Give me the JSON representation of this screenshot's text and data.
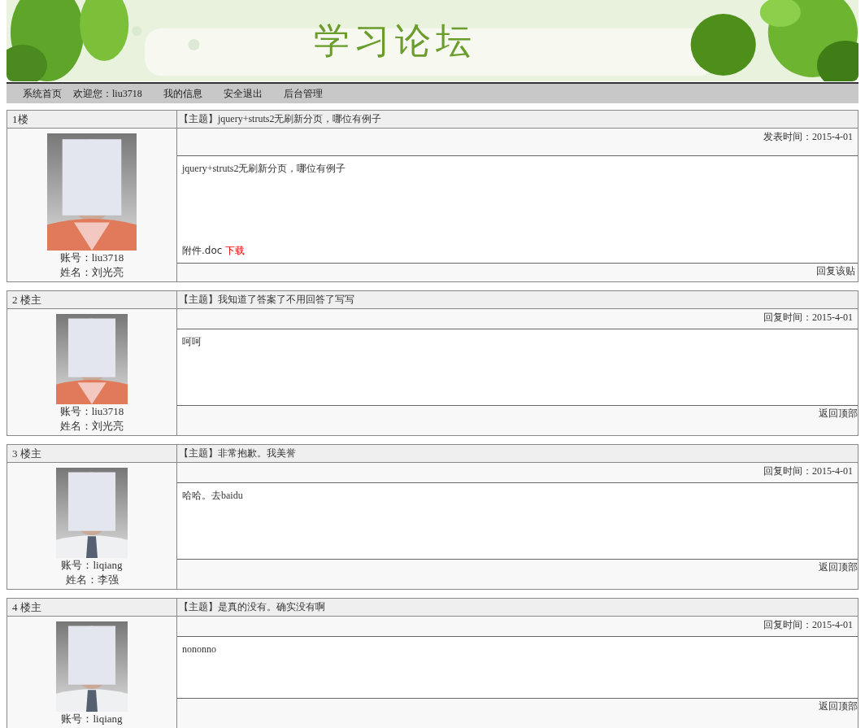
{
  "banner": {
    "title": "学习论坛"
  },
  "nav": [
    "系统首页",
    "欢迎您：liu3718",
    "我的信息",
    "安全退出",
    "后台管理"
  ],
  "posts": [
    {
      "floor": "1楼",
      "subject": "【主题】jquery+struts2无刷新分页，哪位有例子",
      "time": "发表时间：2015-4-01",
      "body": "jquery+struts2无刷新分页，哪位有例子",
      "attachment": {
        "name": "附件.doc",
        "link": "下载"
      },
      "account": "账号：liu3718",
      "name": "姓名：刘光亮",
      "action": "回复该贴"
    },
    {
      "floor": "2 楼主",
      "subject": "【主题】我知道了答案了不用回答了写写",
      "time": "回复时间：2015-4-01",
      "body": "呵呵",
      "account": "账号：liu3718",
      "name": "姓名：刘光亮",
      "action": "返回顶部"
    },
    {
      "floor": "3 楼主",
      "subject": "【主题】非常抱歉。我美誉",
      "time": "回复时间：2015-4-01",
      "body": "哈哈。去baidu",
      "account": "账号：liqiang",
      "name": "姓名：李强",
      "action": "返回顶部"
    },
    {
      "floor": "4 楼主",
      "subject": "【主题】是真的没有。确实没有啊",
      "time": "回复时间：2015-4-01",
      "body": "nononno",
      "account": "账号：liqiang",
      "action": "返回顶部"
    }
  ]
}
